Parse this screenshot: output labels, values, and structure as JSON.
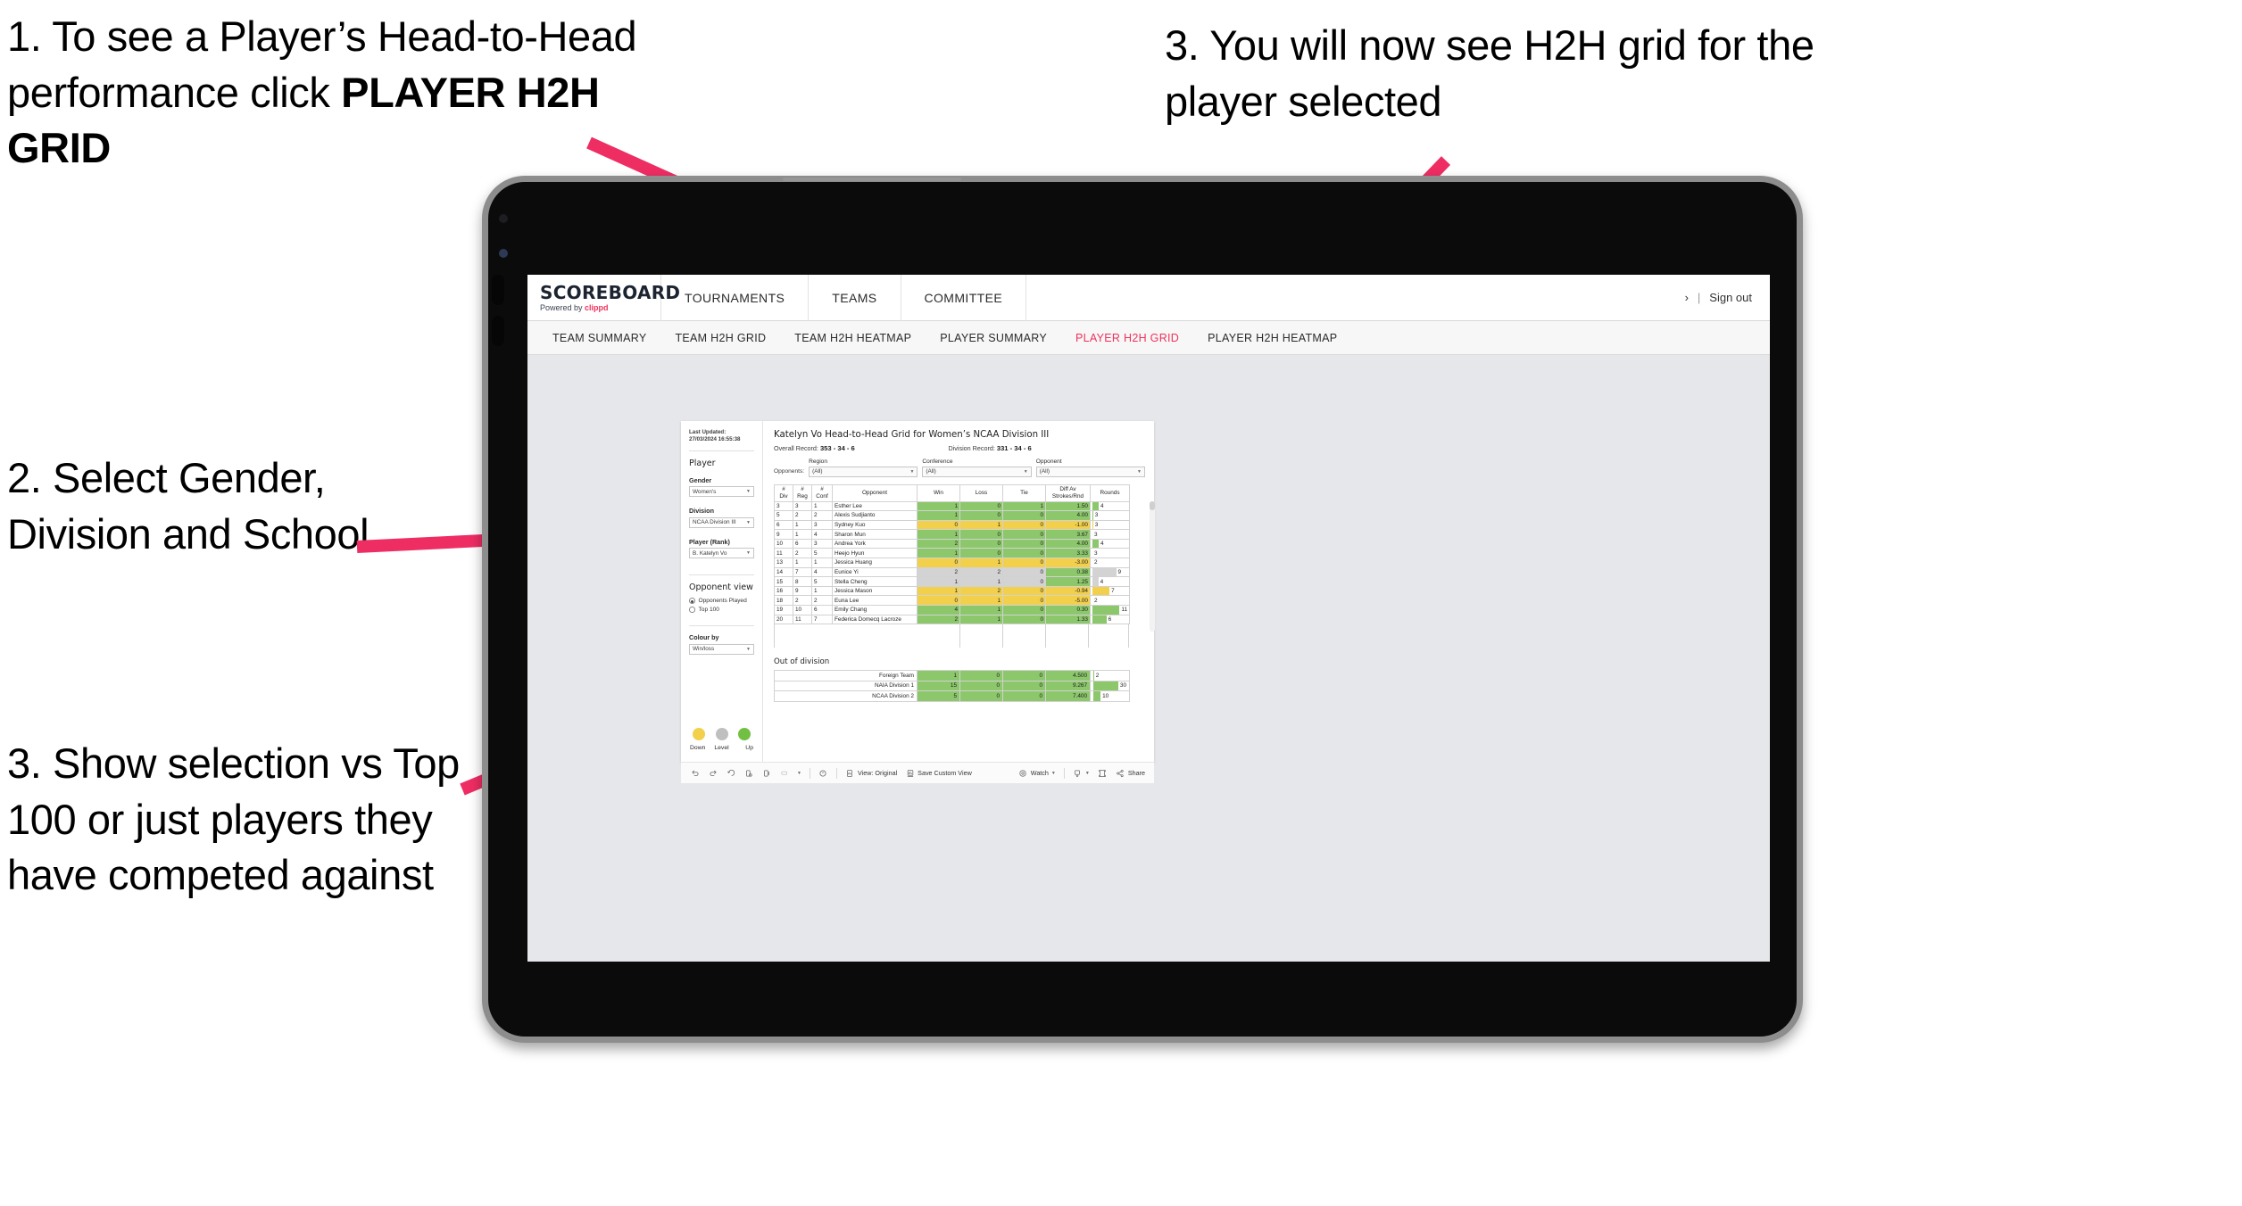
{
  "annotations": [
    {
      "id": "a1",
      "text": "1. To see a Player’s Head-to-Head performance click ",
      "bold": "PLAYER H2H GRID"
    },
    {
      "id": "a2",
      "text": "2. Select Gender, Division and School"
    },
    {
      "id": "a3",
      "text": "3. Show selection vs Top 100 or just players they have competed against"
    },
    {
      "id": "a4",
      "text": "3. You will now see H2H grid for the player selected"
    }
  ],
  "brand": {
    "logo_main": "SCOREBOARD",
    "logo_sub_prefix": "Powered by ",
    "logo_sub_brand": "clippd",
    "accent_color": "#f0325c"
  },
  "topnav": [
    {
      "label": "TOURNAMENTS"
    },
    {
      "label": "TEAMS"
    },
    {
      "label": "COMMITTEE"
    }
  ],
  "account": {
    "user": "›",
    "separator": "|",
    "signout": "Sign out"
  },
  "subnav": [
    {
      "label": "TEAM SUMMARY",
      "active": false
    },
    {
      "label": "TEAM H2H GRID",
      "active": false
    },
    {
      "label": "TEAM H2H HEATMAP",
      "active": false
    },
    {
      "label": "PLAYER SUMMARY",
      "active": false
    },
    {
      "label": "PLAYER H2H GRID",
      "active": true
    },
    {
      "label": "PLAYER H2H HEATMAP",
      "active": false
    }
  ],
  "filters": {
    "last_updated": "Last Updated: 27/03/2024 16:55:38",
    "section_title": "Player",
    "gender": {
      "label": "Gender",
      "value": "Women's"
    },
    "division": {
      "label": "Division",
      "value": "NCAA Division III"
    },
    "player": {
      "label": "Player (Rank)",
      "value": "B. Katelyn Vo"
    },
    "opponent_view": {
      "title": "Opponent view",
      "options": [
        {
          "label": "Opponents Played",
          "selected": true
        },
        {
          "label": "Top 100",
          "selected": false
        }
      ]
    },
    "colour_by": {
      "label": "Colour by",
      "value": "Win/loss"
    },
    "legend": [
      {
        "label": "Down",
        "color": "#f2d04b"
      },
      {
        "label": "Level",
        "color": "#bfbfbf"
      },
      {
        "label": "Up",
        "color": "#72c043"
      }
    ]
  },
  "main": {
    "title": "Katelyn Vo Head-to-Head Grid for Women’s NCAA Division III",
    "overall_record_label": "Overall Record: ",
    "overall_record_value": "353 - 34 - 6",
    "division_record_label": "Division Record: ",
    "division_record_value": "331 - 34 - 6",
    "opponents_label": "Opponents:",
    "opponent_filters": [
      {
        "label": "Region",
        "value": "(All)"
      },
      {
        "label": "Conference",
        "value": "(All)"
      },
      {
        "label": "Opponent",
        "value": "(All)"
      }
    ],
    "out_of_division_title": "Out of division"
  },
  "chart_data": {
    "type": "table",
    "title": "Katelyn Vo Head-to-Head Grid for Women’s NCAA Division III",
    "columns": [
      "# Div",
      "# Reg",
      "# Conf",
      "Opponent",
      "Win",
      "Loss",
      "Tie",
      "Diff Av Strokes/Rnd",
      "Rounds"
    ],
    "column_header_lines": [
      [
        "#",
        "Div"
      ],
      [
        "#",
        "Reg"
      ],
      [
        "#",
        "Conf"
      ],
      [
        "Opponent"
      ],
      [
        "Win"
      ],
      [
        "Loss"
      ],
      [
        "Tie"
      ],
      [
        "Diff Av",
        "Strokes/Rnd"
      ],
      [
        "Rounds"
      ]
    ],
    "rows": [
      {
        "div": "3",
        "reg": "3",
        "conf": "1",
        "opponent": "Esther Lee",
        "win": "1",
        "loss": "0",
        "tie": "1",
        "diff": "1.50",
        "rounds": "4",
        "colour": "up",
        "bar_pct": 18
      },
      {
        "div": "5",
        "reg": "2",
        "conf": "2",
        "opponent": "Alexis Sudjianto",
        "win": "1",
        "loss": "0",
        "tie": "0",
        "diff": "4.00",
        "rounds": "3",
        "colour": "up",
        "bar_pct": 2
      },
      {
        "div": "6",
        "reg": "1",
        "conf": "3",
        "opponent": "Sydney Kuo",
        "win": "0",
        "loss": "1",
        "tie": "0",
        "diff": "-1.00",
        "rounds": "3",
        "colour": "down",
        "bar_pct": 2
      },
      {
        "div": "9",
        "reg": "1",
        "conf": "4",
        "opponent": "Sharon Mun",
        "win": "1",
        "loss": "0",
        "tie": "0",
        "diff": "3.67",
        "rounds": "3",
        "colour": "up",
        "bar_pct": 0
      },
      {
        "div": "10",
        "reg": "6",
        "conf": "3",
        "opponent": "Andrea York",
        "win": "2",
        "loss": "0",
        "tie": "0",
        "diff": "4.00",
        "rounds": "4",
        "colour": "up",
        "bar_pct": 18
      },
      {
        "div": "11",
        "reg": "2",
        "conf": "5",
        "opponent": "Heejo Hyun",
        "win": "1",
        "loss": "0",
        "tie": "0",
        "diff": "3.33",
        "rounds": "3",
        "colour": "up",
        "bar_pct": 0
      },
      {
        "div": "13",
        "reg": "1",
        "conf": "1",
        "opponent": "Jessica Huang",
        "win": "0",
        "loss": "1",
        "tie": "0",
        "diff": "-3.00",
        "rounds": "2",
        "colour": "down",
        "bar_pct": 0
      },
      {
        "div": "14",
        "reg": "7",
        "conf": "4",
        "opponent": "Eunice Yi",
        "win": "2",
        "loss": "2",
        "tie": "0",
        "diff": "0.38",
        "rounds": "9",
        "colour": "level",
        "bar_pct": 68
      },
      {
        "div": "15",
        "reg": "8",
        "conf": "5",
        "opponent": "Stella Cheng",
        "win": "1",
        "loss": "1",
        "tie": "0",
        "diff": "1.25",
        "rounds": "4",
        "colour": "level",
        "bar_pct": 17
      },
      {
        "div": "16",
        "reg": "9",
        "conf": "1",
        "opponent": "Jessica Mason",
        "win": "1",
        "loss": "2",
        "tie": "0",
        "diff": "-0.94",
        "rounds": "7",
        "colour": "down",
        "bar_pct": 49
      },
      {
        "div": "18",
        "reg": "2",
        "conf": "2",
        "opponent": "Euna Lee",
        "win": "0",
        "loss": "1",
        "tie": "0",
        "diff": "-5.00",
        "rounds": "2",
        "colour": "down",
        "bar_pct": 0
      },
      {
        "div": "19",
        "reg": "10",
        "conf": "6",
        "opponent": "Emily Chang",
        "win": "4",
        "loss": "1",
        "tie": "0",
        "diff": "0.30",
        "rounds": "11",
        "colour": "up",
        "bar_pct": 84
      },
      {
        "div": "20",
        "reg": "11",
        "conf": "7",
        "opponent": "Federica Domecq Lacroze",
        "win": "2",
        "loss": "1",
        "tie": "0",
        "diff": "1.33",
        "rounds": "6",
        "colour": "up",
        "bar_pct": 40
      }
    ],
    "out_of_division_rows": [
      {
        "name": "Foreign Team",
        "win": "1",
        "loss": "0",
        "tie": "0",
        "diff": "4.500",
        "rounds": "2",
        "colour": "up",
        "bar_pct": 2
      },
      {
        "name": "NAIA Division 1",
        "win": "15",
        "loss": "0",
        "tie": "0",
        "diff": "9.267",
        "rounds": "30",
        "colour": "up",
        "bar_pct": 88
      },
      {
        "name": "NCAA Division 2",
        "win": "5",
        "loss": "0",
        "tie": "0",
        "diff": "7.400",
        "rounds": "10",
        "colour": "up",
        "bar_pct": 22
      }
    ],
    "colour_map": {
      "up": "#8cc76b",
      "down": "#f2d04b",
      "level": "#d3d3d3",
      "none": "#ffffff"
    }
  },
  "toolbar": {
    "view_label": "View: Original",
    "save_label": "Save Custom View",
    "watch_label": "Watch",
    "share_label": "Share"
  }
}
